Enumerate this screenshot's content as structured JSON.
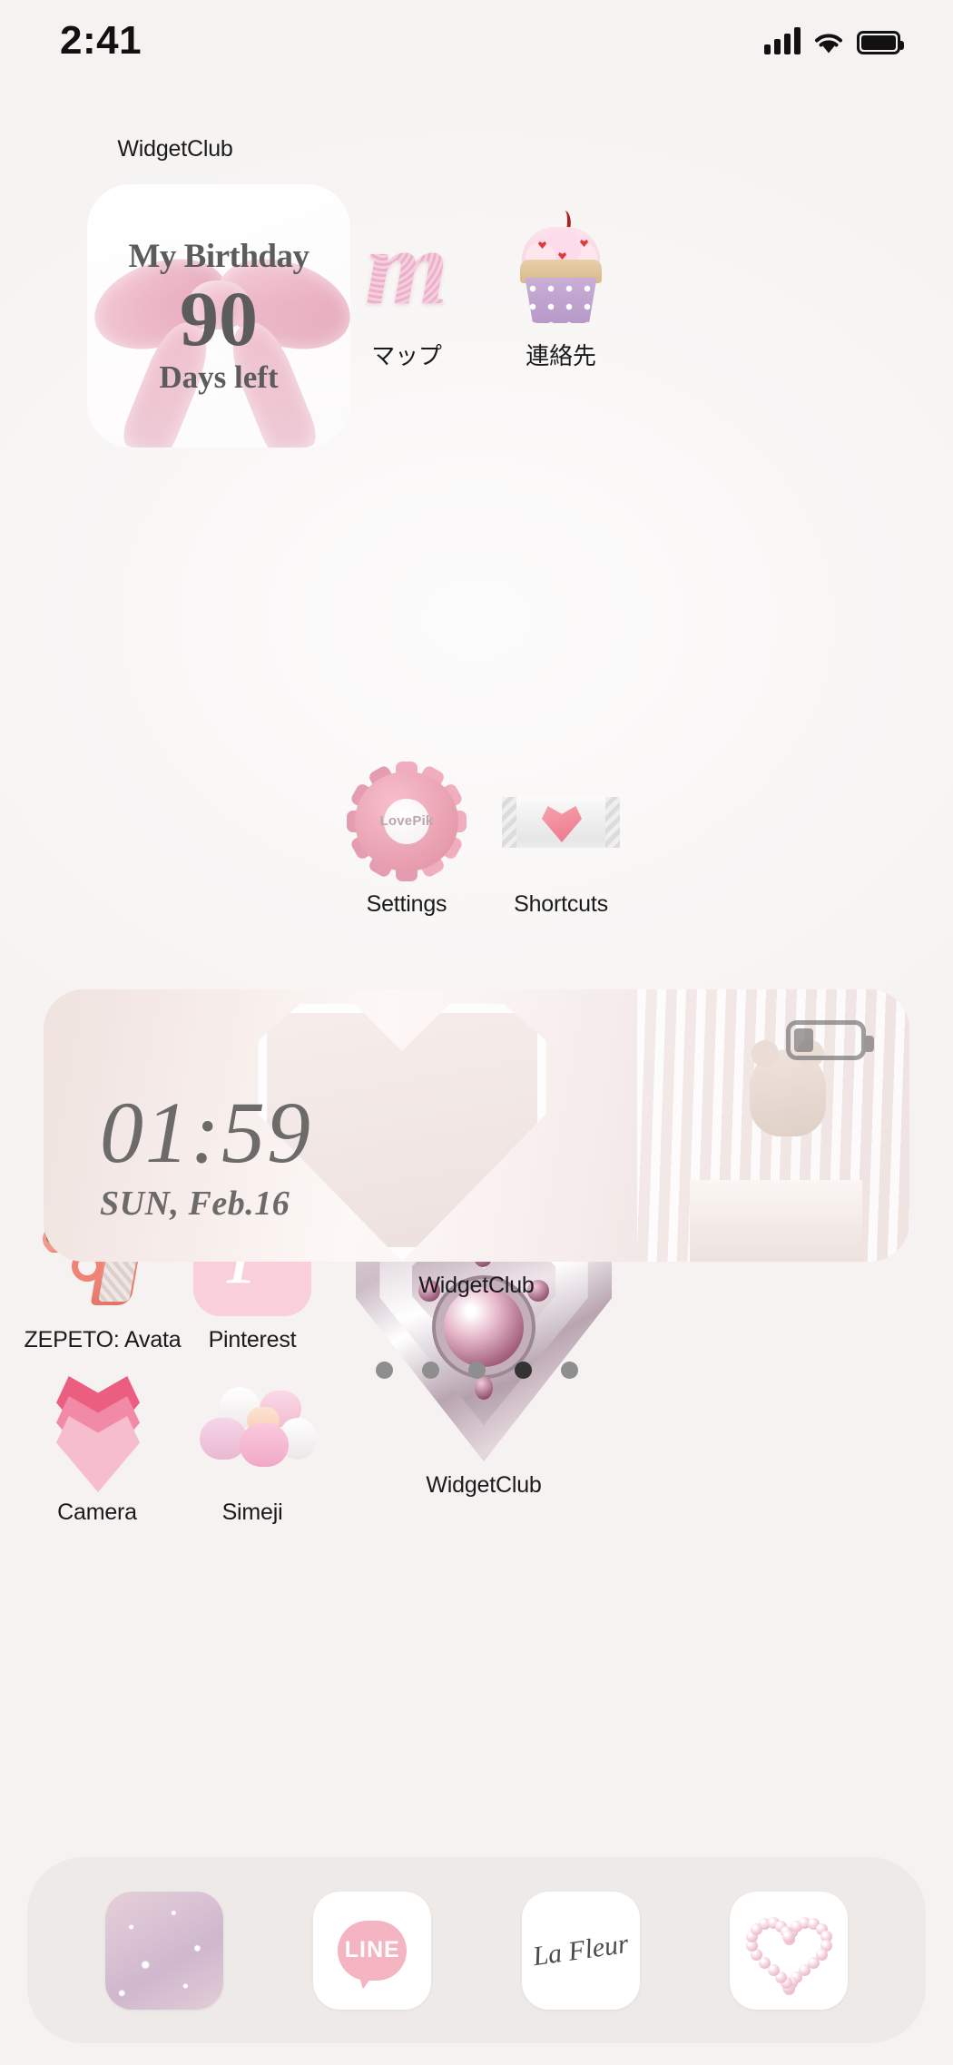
{
  "status_bar": {
    "time": "2:41",
    "cellular_icon": "signal-bars-icon",
    "wifi_icon": "wifi-icon",
    "battery_icon": "battery-full-icon",
    "battery_level": 100
  },
  "home_screen": {
    "widgets": {
      "birthday": {
        "title": "My Birthday",
        "days": "90",
        "subtitle": "Days left",
        "label": "WidgetClub"
      },
      "heart_compact": {
        "label": "WidgetClub"
      },
      "clock": {
        "time": "01:59",
        "date": "SUN, Feb.16",
        "label": "WidgetClub",
        "battery_level": 30
      }
    },
    "apps": [
      {
        "label": "マップ",
        "icon": "pearl-letter-m-icon"
      },
      {
        "label": "連絡先",
        "icon": "cupcake-icon"
      },
      {
        "label": "Settings",
        "icon": "pink-gear-icon",
        "watermark": "LovePik"
      },
      {
        "label": "Shortcuts",
        "icon": "wrapped-heart-candy-icon"
      },
      {
        "label": "ZEPETO: Avata",
        "icon": "pink-pistol-icon"
      },
      {
        "label": "Pinterest",
        "icon": "pinterest-p-icon"
      },
      {
        "label": "Camera",
        "icon": "stacked-hearts-icon"
      },
      {
        "label": "Simeji",
        "icon": "marshmallows-icon"
      }
    ],
    "page_indicator": {
      "total": 5,
      "active_index": 3
    },
    "dock": [
      {
        "name": "fairy-lights-app",
        "icon": "pink-fairy-lights-icon"
      },
      {
        "name": "line-app",
        "icon": "line-logo-icon",
        "text": "LINE"
      },
      {
        "name": "la-fleur-app",
        "icon": "la-fleur-script-icon",
        "text": "La Fleur"
      },
      {
        "name": "pearl-heart-app",
        "icon": "pearl-heart-icon"
      }
    ]
  },
  "colors": {
    "background": "#f7f5f4",
    "accent_pink": "#f4b4c2",
    "pinterest_pink": "#f9cfd9",
    "label_text": "#1a1a1a",
    "dock_background": "#ebe9e7"
  }
}
